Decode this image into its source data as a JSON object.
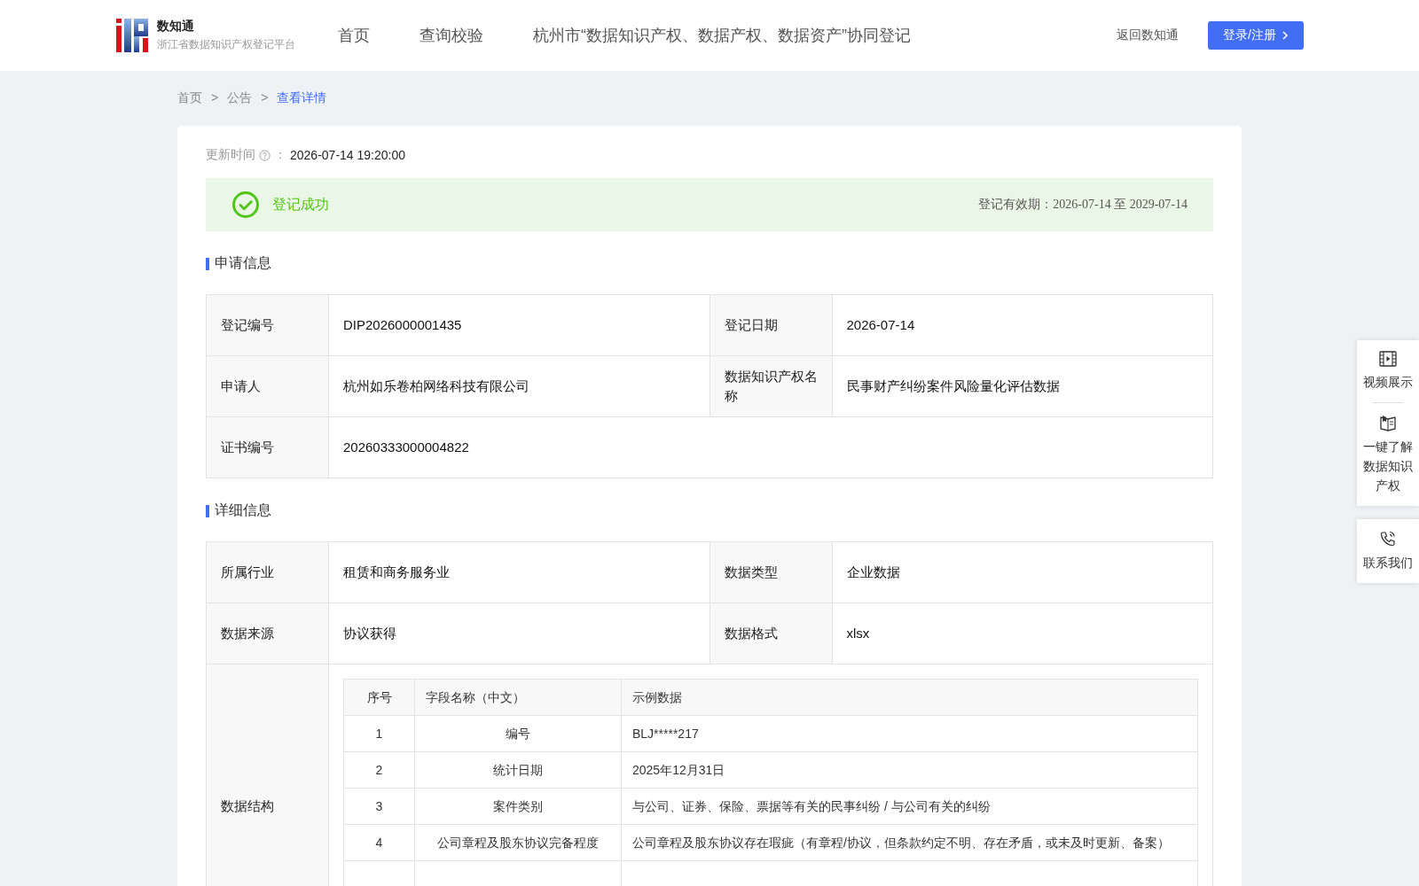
{
  "header": {
    "logo_title": "数知通",
    "logo_subtitle": "浙江省数据知识产权登记平台",
    "nav": [
      {
        "label": "首页",
        "selected": false
      },
      {
        "label": "查询校验",
        "selected": false
      },
      {
        "label": "杭州市“数据知识产权、数据产权、数据资产”协同登记",
        "selected": false
      }
    ],
    "back_link": "返回数知通",
    "login_button": "登录/注册"
  },
  "breadcrumb": [
    {
      "kind": "link",
      "label": "首页"
    },
    {
      "kind": "separator",
      "label": ">"
    },
    {
      "kind": "link",
      "label": "公告"
    },
    {
      "kind": "separator",
      "label": ">"
    },
    {
      "kind": "current",
      "label": "查看详情"
    }
  ],
  "update": {
    "label": "更新时间",
    "colon": "：",
    "value": "2026-07-14 19:20:00"
  },
  "status": {
    "text": "登记成功",
    "validity": "登记有效期：2026-07-14 至 2029-07-14"
  },
  "sections": [
    {
      "title": "申请信息",
      "rows": [
        [
          {
            "label": "登记编号",
            "value": "DIP2026000001435"
          },
          {
            "label": "登记日期",
            "value": "2026-07-14"
          }
        ],
        [
          {
            "label": "申请人",
            "value": "杭州如乐卷柏网络科技有限公司"
          },
          {
            "label": "数据知识产权名称",
            "value": "民事财产纠纷案件风险量化评估数据"
          }
        ],
        [
          {
            "label": "证书编号",
            "value": "20260333000004822"
          }
        ]
      ]
    },
    {
      "title": "详细信息",
      "rows": [
        [
          {
            "label": "所属行业",
            "value": "租赁和商务服务业"
          },
          {
            "label": "数据类型",
            "value": "企业数据"
          }
        ],
        [
          {
            "label": "数据来源",
            "value": "协议获得"
          },
          {
            "label": "数据格式",
            "value": "xlsx"
          }
        ]
      ],
      "structure": {
        "label": "数据结构",
        "columns": [
          "序号",
          "字段名称（中文）",
          "示例数据"
        ],
        "rows": [
          [
            "1",
            "编号",
            "BLJ*****217"
          ],
          [
            "2",
            "统计日期",
            "2025年12月31日"
          ],
          [
            "3",
            "案件类别",
            "与公司、证券、保险、票据等有关的民事纠纷 / 与公司有关的纠纷"
          ],
          [
            "4",
            "公司章程及股东协议完备程度",
            "公司章程及股东协议存在瑕疵（有章程/协议，但条款约定不明、存在矛盾，或未及时更新、备案）"
          ]
        ]
      }
    }
  ],
  "side_panel": [
    {
      "kind": "video",
      "label": "视频展示"
    },
    {
      "kind": "book",
      "label": "一键了解数据知识产权"
    },
    {
      "kind": "phone",
      "label": "联系我们"
    }
  ]
}
